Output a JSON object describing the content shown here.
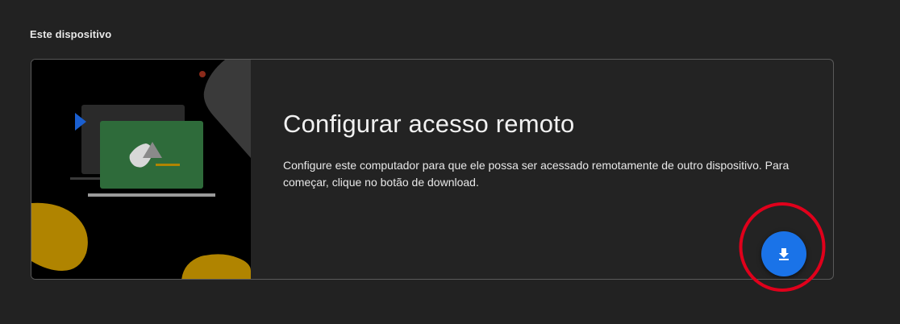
{
  "section": {
    "title": "Este dispositivo"
  },
  "card": {
    "title": "Configurar acesso remoto",
    "description": "Configure este computador para que ele possa ser acessado remotamente de outro dispositivo. Para começar, clique no botão de download.",
    "download_button_icon": "download-icon"
  },
  "colors": {
    "accent": "#1a73e8",
    "highlight": "#e0001b",
    "illustration_green": "#2e6b3a",
    "illustration_yellow": "#b08400",
    "background": "#222222"
  }
}
